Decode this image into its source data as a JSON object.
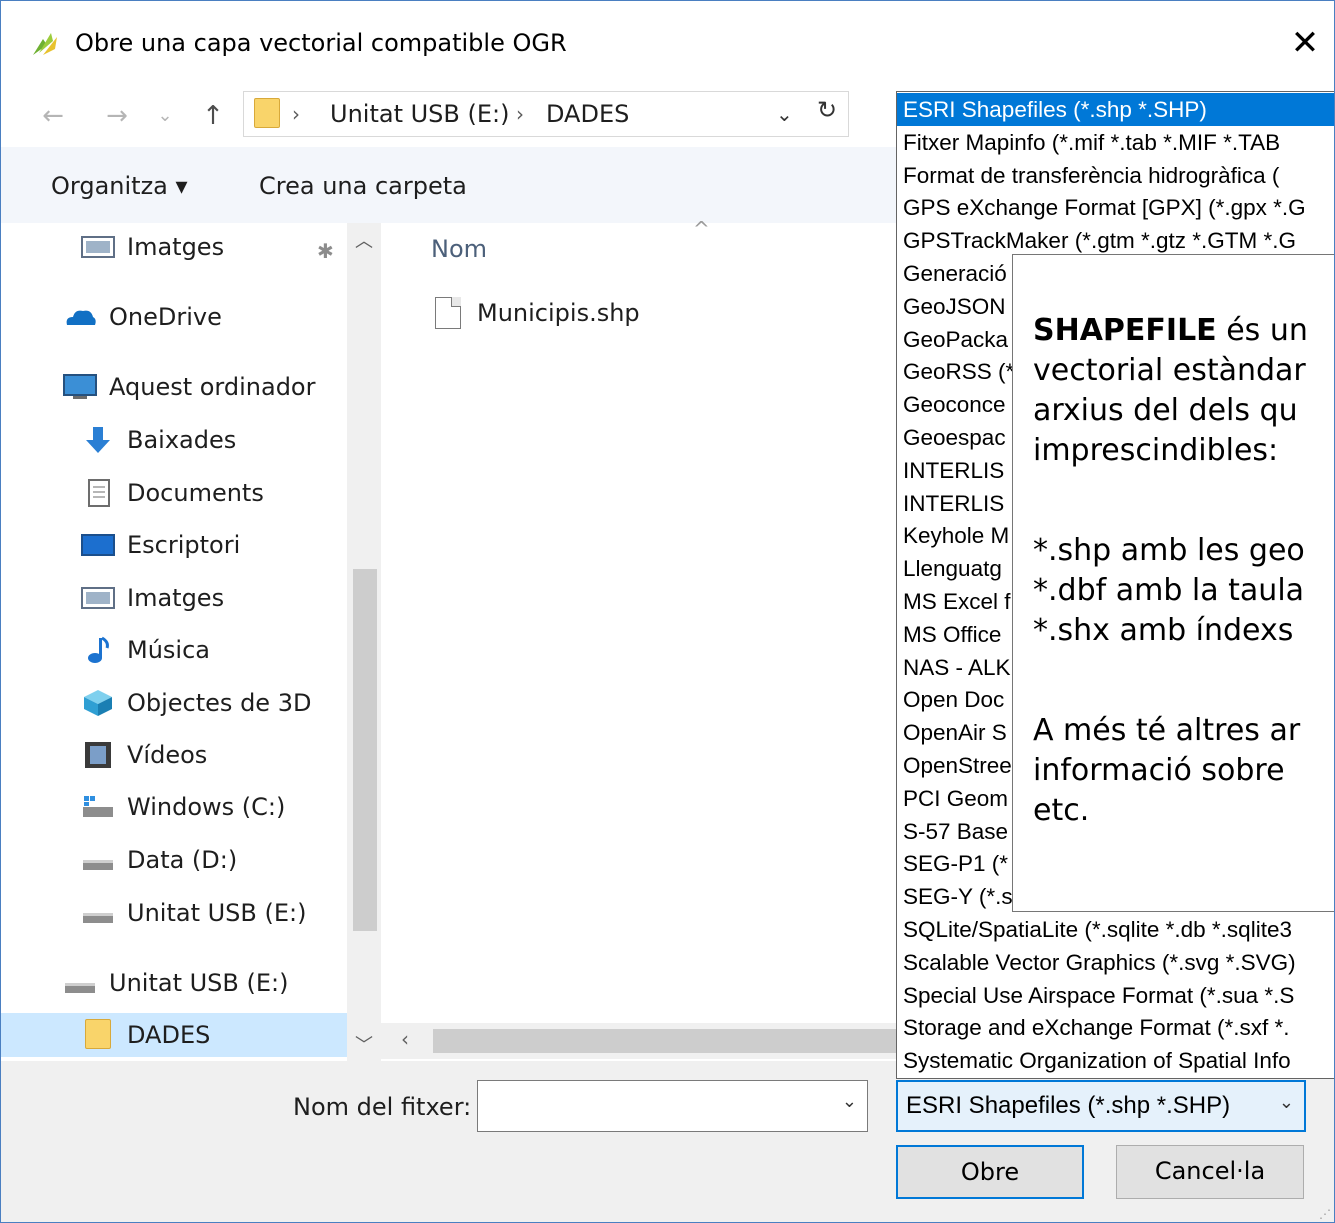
{
  "window": {
    "title": "Obre una capa vectorial compatible OGR",
    "close_glyph": "✕"
  },
  "nav": {
    "back_glyph": "←",
    "forward_glyph": "→",
    "recent_glyph": "⌄",
    "up_glyph": "↑",
    "crumbs": [
      "Unitat USB (E:)",
      "DADES"
    ],
    "crumb_sep": "›",
    "dropdown_glyph": "⌄",
    "refresh_glyph": "↻"
  },
  "commands": {
    "organize": "Organitza ▾",
    "new_folder": "Crea una carpeta"
  },
  "sidebar": {
    "items": [
      {
        "label": "Imatges",
        "icon": "pictures-icon"
      },
      {
        "label": "OneDrive",
        "icon": "onedrive-icon"
      },
      {
        "label": "Aquest ordinador",
        "icon": "computer-icon"
      },
      {
        "label": "Baixades",
        "icon": "downloads-icon"
      },
      {
        "label": "Documents",
        "icon": "documents-icon"
      },
      {
        "label": "Escriptori",
        "icon": "desktop-icon"
      },
      {
        "label": "Imatges",
        "icon": "pictures-icon"
      },
      {
        "label": "Música",
        "icon": "music-icon"
      },
      {
        "label": "Objectes de 3D",
        "icon": "3d-objects-icon"
      },
      {
        "label": "Vídeos",
        "icon": "videos-icon"
      },
      {
        "label": "Windows (C:)",
        "icon": "windows-drive-icon"
      },
      {
        "label": "Data (D:)",
        "icon": "drive-icon"
      },
      {
        "label": "Unitat USB (E:)",
        "icon": "drive-icon"
      },
      {
        "label": "Unitat USB (E:)",
        "icon": "drive-icon"
      },
      {
        "label": "DADES",
        "icon": "folder-icon"
      }
    ],
    "pin_glyph": "📌"
  },
  "content": {
    "column_name": "Nom",
    "files": [
      {
        "name": "Municipis.shp"
      }
    ]
  },
  "bottom": {
    "filename_label": "Nom del fitxer:",
    "filename_value": "",
    "filter_value": "ESRI Shapefiles (*.shp *.SHP)",
    "open_label": "Obre",
    "cancel_label": "Cancel·la"
  },
  "filter_options": [
    "ESRI Shapefiles (*.shp *.SHP)",
    "Fitxer Mapinfo (*.mif *.tab *.MIF *.TAB",
    "Format de transferència hidrogràfica (",
    "GPS eXchange Format [GPX] (*.gpx *.G",
    "GPSTrackMaker (*.gtm *.gtz *.GTM *.G",
    "Generació",
    "GeoJSON",
    "GeoPacka",
    "GeoRSS (*",
    "Geoconce",
    "Geoespac",
    "INTERLIS",
    "INTERLIS",
    "Keyhole M",
    "Llenguatg",
    "MS Excel f",
    "MS Office",
    "NAS - ALK",
    "Open Doc",
    "OpenAir S",
    "OpenStree",
    "PCI Geom",
    "S-57 Base",
    "SEG-P1 (*",
    "SEG-Y (*.s",
    "SQLite/SpatiaLite (*.sqlite *.db *.sqlite3",
    "Scalable Vector Graphics (*.svg *.SVG)",
    "Special Use Airspace Format (*.sua *.S",
    "Storage and eXchange Format (*.sxf *.",
    "Systematic Organization of Spatial Info"
  ],
  "tooltip": {
    "bold": "SHAPEFILE",
    "line1_rest": " és un",
    "line2": "vectorial estàndar",
    "line3": "arxius del dels qu",
    "line4": "imprescindibles:",
    "line5": "*.shp amb les geo",
    "line6": "*.dbf amb la taula",
    "line7": "*.shx amb índexs",
    "line8": "A més té altres ar",
    "line9": "informació sobre",
    "line10": "etc."
  }
}
